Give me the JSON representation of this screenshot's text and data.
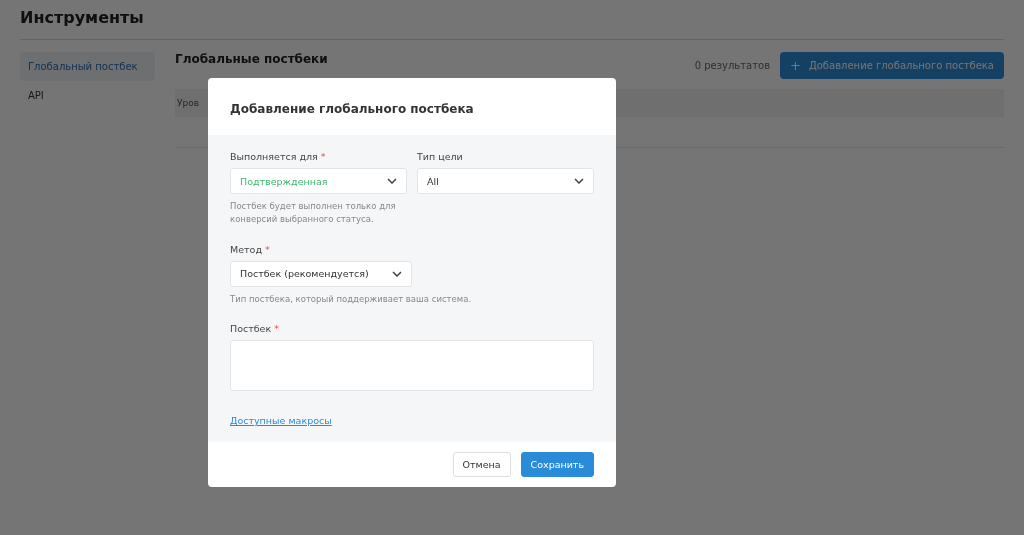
{
  "page": {
    "title": "Инструменты"
  },
  "sidebar": {
    "items": [
      {
        "label": "Глобальный постбек",
        "selected": true
      },
      {
        "label": "API",
        "selected": false
      }
    ]
  },
  "content": {
    "title": "Глобальные постбеки",
    "results": "0 результатов",
    "add_button": {
      "icon": "+",
      "label": "Добавление глобального постбека"
    },
    "table": {
      "columns": [
        "Уров"
      ]
    }
  },
  "modal": {
    "title": "Добавление глобального постбека",
    "rows": [
      [
        {
          "kind": "select",
          "label": "Выполняется для",
          "required": true,
          "value": "Подтвержденная",
          "color": "#3db96b",
          "hint": "Постбек будет выполнен только для конверсий выбранного статуса."
        },
        {
          "kind": "select",
          "label": "Тип цели",
          "required": false,
          "value": "All"
        }
      ],
      [
        {
          "kind": "select",
          "label": "Метод",
          "required": true,
          "value": "Постбек (рекомендуется)",
          "hint": "Тип постбека, который поддерживает ваша система."
        }
      ],
      [
        {
          "kind": "textarea",
          "label": "Постбек",
          "required": true
        }
      ]
    ],
    "required_mark": "*",
    "link": "Доступные макросы",
    "buttons": [
      {
        "label": "Отмена",
        "kind": "secondary"
      },
      {
        "label": "Сохранить",
        "kind": "primary"
      }
    ]
  }
}
